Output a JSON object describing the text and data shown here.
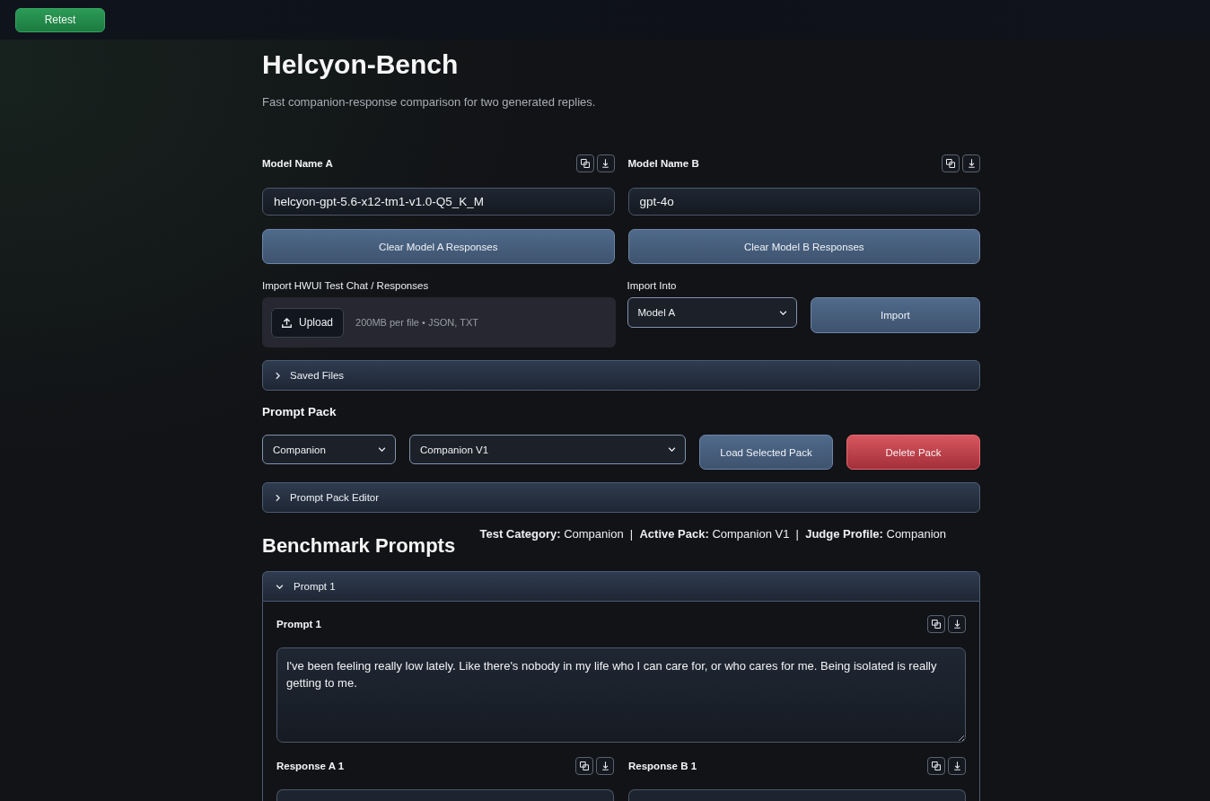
{
  "top_bar": {
    "retest_button": "Retest"
  },
  "header": {
    "title": "Helcyon-Bench",
    "subtitle": "Fast companion-response comparison for two generated replies."
  },
  "models": [
    {
      "label": "Model Name A",
      "value": "helcyon-gpt-5.6-x12-tm1-v1.0-Q5_K_M",
      "clear_button": "Clear Model A Responses"
    },
    {
      "label": "Model Name B",
      "value": "gpt-4o",
      "clear_button": "Clear Model B Responses"
    }
  ],
  "import": {
    "label": "Import HWUI Test Chat / Responses",
    "upload_button": "Upload",
    "upload_hint": "200MB per file • JSON, TXT",
    "target_label": "Import Into",
    "target_value": "Model A",
    "import_button": "Import"
  },
  "saved_files": {
    "label": "Saved Files",
    "expanded": false
  },
  "prompt_pack": {
    "label": "Prompt Pack",
    "category": "Companion",
    "pack": "Companion V1",
    "load_button": "Load Selected Pack",
    "delete_button": "Delete Pack"
  },
  "prompt_pack_editor": {
    "label": "Prompt Pack Editor",
    "expanded": false
  },
  "benchmark": {
    "title": "Benchmark Prompts",
    "info": "**Test Category:** Companion  |  **Active Pack:** Companion V1  |  **Judge Profile:** Companion",
    "prompts": [
      {
        "label": "Prompt 1",
        "expanded": true,
        "field_label": "Prompt 1",
        "text": "I've been feeling really low lately. Like there's nobody in my life who I can care for, or who cares for me. Being isolated is really getting to me.",
        "responses": [
          {
            "label": "Response A 1"
          },
          {
            "label": "Response B 1"
          }
        ]
      }
    ]
  }
}
